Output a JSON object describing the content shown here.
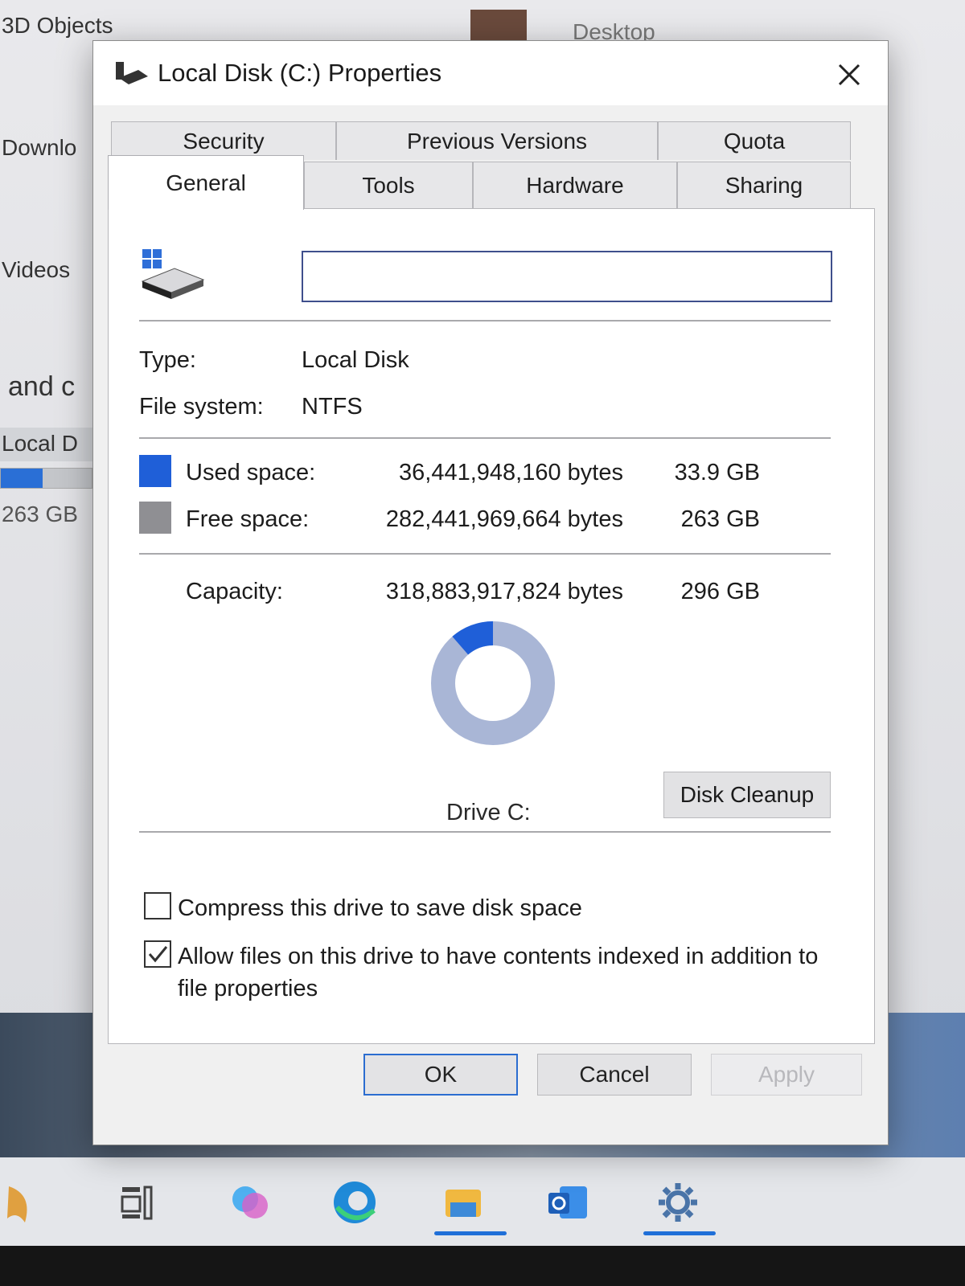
{
  "background": {
    "items": [
      "3D Objects",
      "Desktop",
      "Downlo",
      "Videos",
      "and c",
      "Local D",
      "263 GB"
    ]
  },
  "dialog": {
    "title": "Local Disk (C:) Properties",
    "tabs": {
      "row1": [
        "Security",
        "Previous Versions",
        "Quota"
      ],
      "row2": [
        "General",
        "Tools",
        "Hardware",
        "Sharing"
      ],
      "active": "General"
    },
    "name_value": "",
    "type_label": "Type:",
    "type_value": "Local Disk",
    "fs_label": "File system:",
    "fs_value": "NTFS",
    "used_label": "Used space:",
    "used_bytes": "36,441,948,160 bytes",
    "used_gb": "33.9 GB",
    "free_label": "Free space:",
    "free_bytes": "282,441,969,664 bytes",
    "free_gb": "263 GB",
    "capacity_label": "Capacity:",
    "capacity_bytes": "318,883,917,824 bytes",
    "capacity_gb": "296 GB",
    "used_fraction": 0.114,
    "drive_caption": "Drive C:",
    "cleanup_label": "Disk Cleanup",
    "compress_label": "Compress this drive to save disk space",
    "compress_checked": false,
    "index_label": "Allow files on this drive to have contents indexed in addition to file properties",
    "index_checked": true,
    "ok_label": "OK",
    "cancel_label": "Cancel",
    "apply_label": "Apply",
    "colors": {
      "used": "#1f5fd8",
      "free": "#8f8f93"
    }
  }
}
